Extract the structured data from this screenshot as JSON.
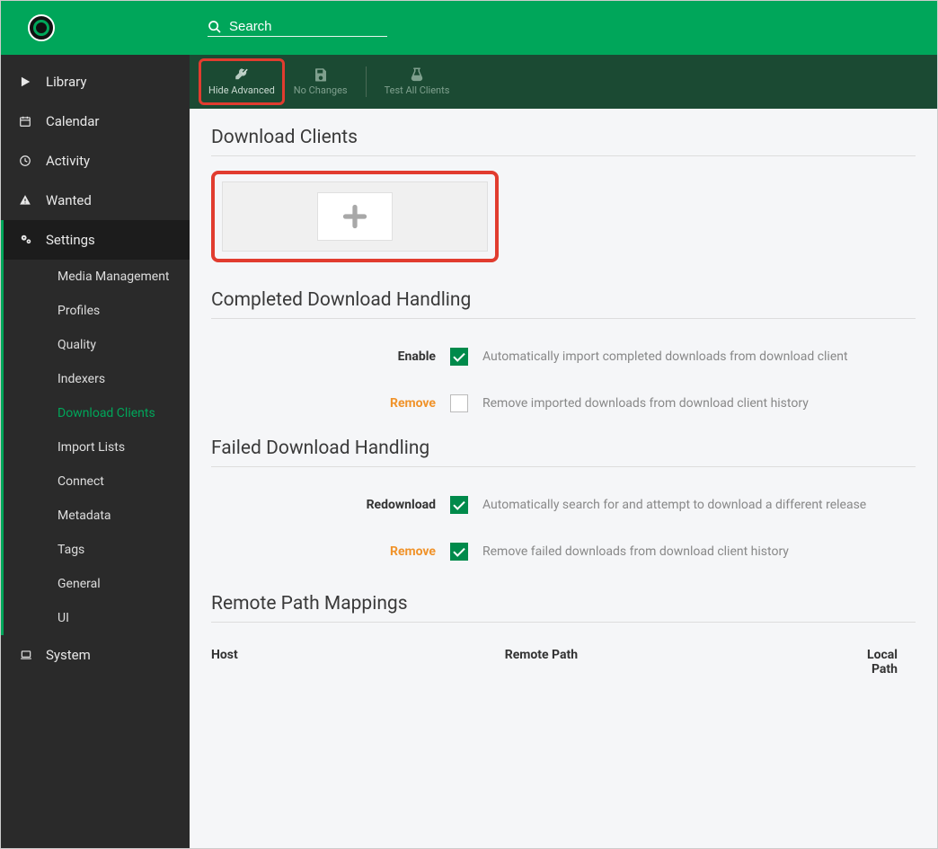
{
  "header": {
    "search_placeholder": "Search"
  },
  "sidebar": {
    "items": [
      {
        "label": "Library"
      },
      {
        "label": "Calendar"
      },
      {
        "label": "Activity"
      },
      {
        "label": "Wanted"
      },
      {
        "label": "Settings"
      },
      {
        "label": "System"
      }
    ],
    "settings_sub": [
      {
        "label": "Media Management"
      },
      {
        "label": "Profiles"
      },
      {
        "label": "Quality"
      },
      {
        "label": "Indexers"
      },
      {
        "label": "Download Clients"
      },
      {
        "label": "Import Lists"
      },
      {
        "label": "Connect"
      },
      {
        "label": "Metadata"
      },
      {
        "label": "Tags"
      },
      {
        "label": "General"
      },
      {
        "label": "UI"
      }
    ]
  },
  "toolbar": {
    "hide_advanced": "Hide Advanced",
    "no_changes": "No Changes",
    "test_all": "Test All Clients"
  },
  "sections": {
    "download_clients": "Download Clients",
    "completed": "Completed Download Handling",
    "failed": "Failed Download Handling",
    "remote": "Remote Path Mappings"
  },
  "completed": {
    "enable_label": "Enable",
    "enable_help": "Automatically import completed downloads from download client",
    "remove_label": "Remove",
    "remove_help": "Remove imported downloads from download client history"
  },
  "failed": {
    "redownload_label": "Redownload",
    "redownload_help": "Automatically search for and attempt to download a different release",
    "remove_label": "Remove",
    "remove_help": "Remove failed downloads from download client history"
  },
  "mapping": {
    "host": "Host",
    "remote_path": "Remote Path",
    "local_path": "Local Path"
  }
}
